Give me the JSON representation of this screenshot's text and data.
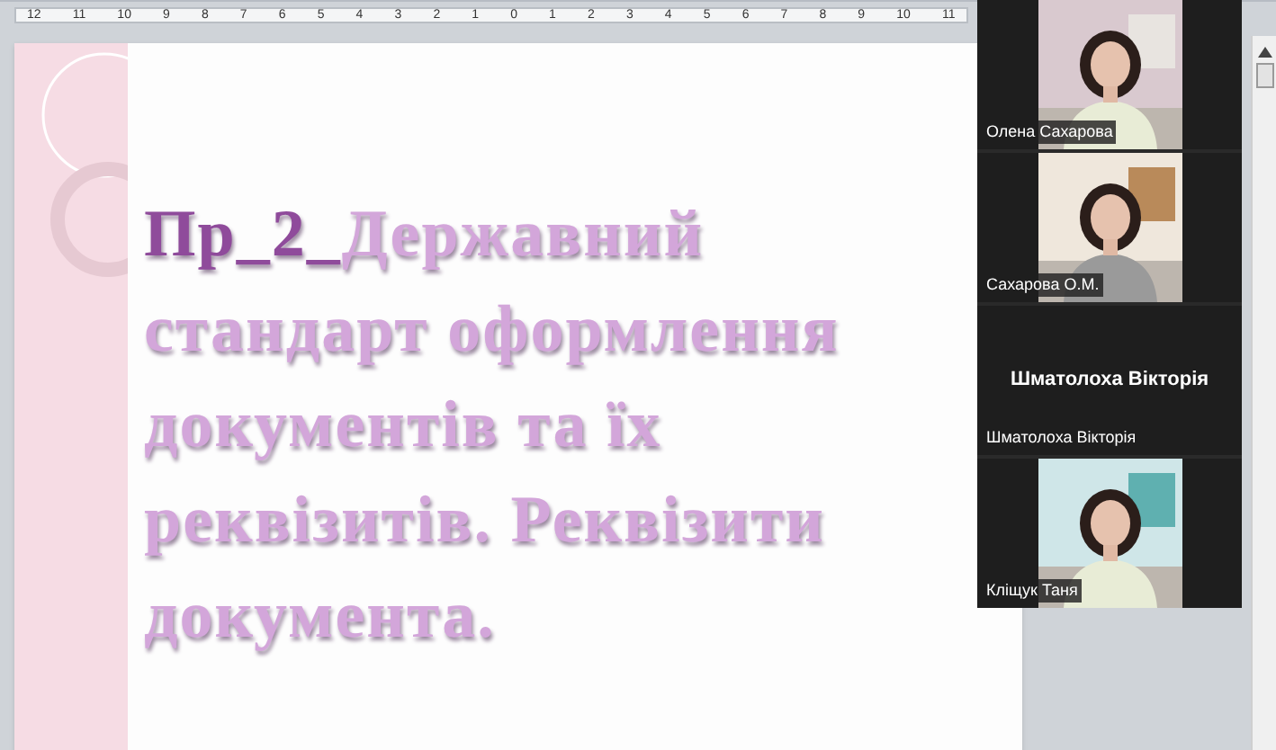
{
  "ruler": {
    "ticks": [
      "12",
      "11",
      "10",
      "9",
      "8",
      "7",
      "6",
      "5",
      "4",
      "3",
      "2",
      "1",
      "0",
      "1",
      "2",
      "3",
      "4",
      "5",
      "6",
      "7",
      "8",
      "9",
      "10",
      "11"
    ]
  },
  "slide": {
    "title": {
      "prefix": "Пр_2_",
      "text": "Державний стандарт  оформлення документів  та  їх реквізитів. Реквізити документа."
    }
  },
  "participants": [
    {
      "kind": "video",
      "name": "Олена Сахарова"
    },
    {
      "kind": "video",
      "name": "Сахарова О.М."
    },
    {
      "kind": "no_video",
      "name": "Шматолоха Вікторія",
      "display_name": "Шматолоха Вікторія"
    },
    {
      "kind": "video",
      "name": "Кліщук Таня"
    }
  ]
}
